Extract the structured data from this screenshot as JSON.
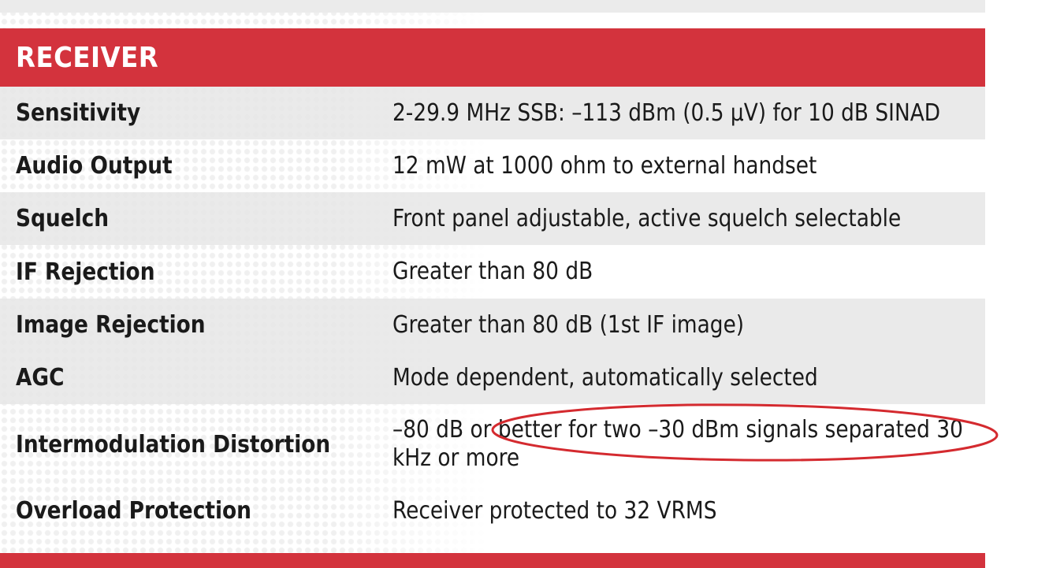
{
  "section": {
    "title": "RECEIVER"
  },
  "rows": [
    {
      "label": "Sensitivity",
      "value": "2-29.9 MHz SSB: –113 dBm (0.5 µV) for 10 dB SINAD"
    },
    {
      "label": "Audio Output",
      "value": "12 mW at 1000 ohm to external handset"
    },
    {
      "label": "Squelch",
      "value": "Front panel adjustable, active squelch selectable"
    },
    {
      "label": "IF Rejection",
      "value": "Greater than 80 dB"
    },
    {
      "label": "Image Rejection",
      "value": "Greater than 80 dB (1st IF image)"
    },
    {
      "label": "AGC",
      "value": "Mode dependent, automatically selected"
    },
    {
      "label": "Intermodulation Distortion",
      "value_line1": "–80 dB or better for two –30 dBm signals separated 30",
      "value_line2": "kHz or more"
    },
    {
      "label": "Overload Protection",
      "value": "Receiver protected to 32 VRMS"
    }
  ],
  "colors": {
    "header_red": "#d3333d",
    "annotation_red": "#d42a2f",
    "row_shade": "#e6e6e6"
  }
}
